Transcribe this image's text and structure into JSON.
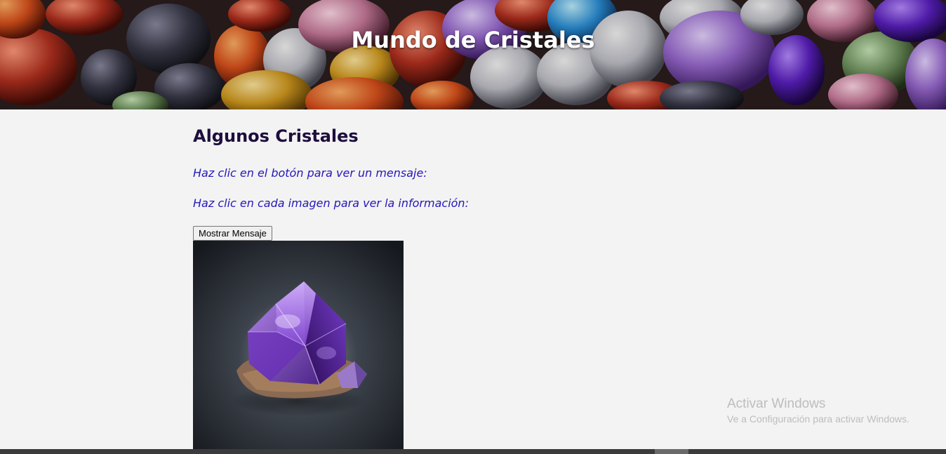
{
  "header": {
    "title": "Mundo de Cristales"
  },
  "main": {
    "section_title": "Algunos Cristales",
    "hint_button": "Haz clic en el botón para ver un mensaje:",
    "hint_images": "Haz clic en cada imagen para ver la información:",
    "show_message_button": "Mostrar Mensaje",
    "crystal_image_icon": "amethyst-crystal-image"
  },
  "watermark": {
    "title": "Activar Windows",
    "subtitle": "Ve a Configuración para activar Windows."
  },
  "colors": {
    "page_background": "#f3f3f3",
    "section_title": "#1f0d3d",
    "hint_text": "#2418b8",
    "header_title": "#ffffff",
    "watermark": "#bdbdbd"
  }
}
